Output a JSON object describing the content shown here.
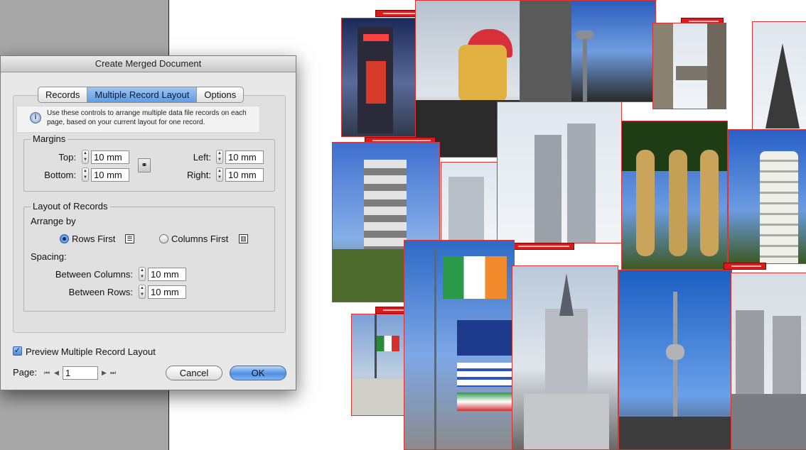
{
  "dialog": {
    "title": "Create Merged Document",
    "tabs": [
      "Records",
      "Multiple Record Layout",
      "Options"
    ],
    "info_text": "Use these controls to arrange multiple data file records on each page, based on your current layout for one record.",
    "margins": {
      "legend": "Margins",
      "top_label": "Top:",
      "top_value": "10 mm",
      "bottom_label": "Bottom:",
      "bottom_value": "10 mm",
      "left_label": "Left:",
      "left_value": "10 mm",
      "right_label": "Right:",
      "right_value": "10 mm"
    },
    "layout": {
      "legend": "Layout of Records",
      "arrange_by_label": "Arrange by",
      "rows_first": "Rows First",
      "columns_first": "Columns First",
      "spacing_label": "Spacing:",
      "between_columns_label": "Between Columns:",
      "between_columns_value": "10 mm",
      "between_rows_label": "Between Rows:",
      "between_rows_value": "10 mm"
    },
    "preview_label": "Preview Multiple Record Layout",
    "page_label": "Page:",
    "page_value": "1",
    "cancel": "Cancel",
    "ok": "OK"
  },
  "colors": {
    "record_frame": "#d61c1c",
    "accent_blue": "#5f9de6"
  },
  "icons": [
    "info-icon",
    "link-icon",
    "rows-first-icon",
    "columns-first-icon",
    "first-page-icon",
    "prev-page-icon",
    "next-page-icon",
    "last-page-icon"
  ]
}
